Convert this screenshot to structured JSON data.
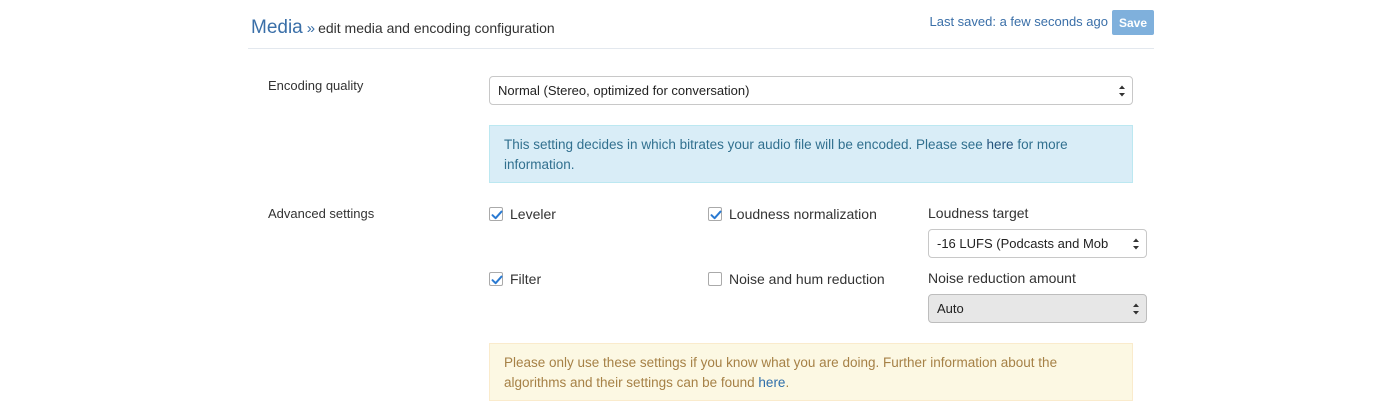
{
  "header": {
    "section_link": "Media",
    "separator": "»",
    "subtitle": "edit media and encoding configuration",
    "last_saved": "Last saved: a few seconds ago",
    "save_label": "Save"
  },
  "encoding": {
    "label": "Encoding quality",
    "selected": "Normal (Stereo, optimized for conversation)",
    "info_text": "This setting decides in which bitrates your audio file will be encoded. Please see",
    "info_link": "here",
    "info_text_after": "for more information."
  },
  "advanced": {
    "label": "Advanced settings",
    "leveler": {
      "label": "Leveler",
      "checked": true
    },
    "loudness_normalization": {
      "label": "Loudness normalization",
      "checked": true
    },
    "filter": {
      "label": "Filter",
      "checked": true
    },
    "noise_reduction": {
      "label": "Noise and hum reduction",
      "checked": false
    },
    "loudness_target": {
      "label": "Loudness target",
      "selected": "-16 LUFS (Podcasts and Mob"
    },
    "noise_amount": {
      "label": "Noise reduction amount",
      "selected": "Auto"
    },
    "warning_text": "Please only use these settings if you know what you are doing. Further information about the algorithms and their settings can be found",
    "warning_link": "here",
    "warning_after": "."
  },
  "colors": {
    "accent": "#3a6fa8",
    "save_button": "#7fb0dc",
    "info_bg": "#d9edf7",
    "warning_bg": "#fcf8e3",
    "checkbox_blue": "#2a7ad2"
  }
}
